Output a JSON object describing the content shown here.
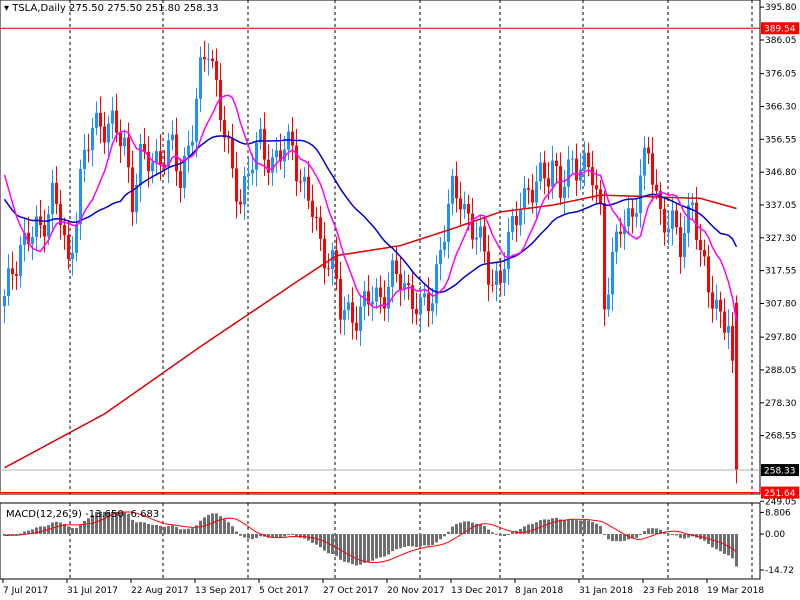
{
  "header": {
    "symbol": "TSLA,Daily",
    "open": "275.50",
    "high": "275.50",
    "low": "251.80",
    "close": "258.33"
  },
  "macd_header": {
    "label": "MACD(12,26,9)",
    "main": "-13.650",
    "signal": "-6.683"
  },
  "colors": {
    "bull": "#1e90ff",
    "bear": "#ff0000",
    "ma_fast": "#ff00ff",
    "ma_mid": "#0000cd",
    "ma_slow": "#e00000",
    "hist": "#6e6e6e",
    "signal": "#ff0000"
  },
  "chart_data": {
    "type": "candlestick",
    "title": "TSLA,Daily",
    "price_ticks": [
      "395.80",
      "386.05",
      "376.05",
      "366.30",
      "356.55",
      "346.80",
      "337.05",
      "327.30",
      "317.55",
      "307.80",
      "297.80",
      "288.05",
      "278.30",
      "268.55",
      "249.05"
    ],
    "price_range": [
      249.05,
      395.8
    ],
    "price_tags": [
      {
        "value": "389.54",
        "kind": "red-line"
      },
      {
        "value": "258.33",
        "kind": "last-price"
      },
      {
        "value": "251.64",
        "kind": "red-line"
      }
    ],
    "date_labels": [
      "7 Jul 2017",
      "31 Jul 2017",
      "22 Aug 2017",
      "13 Sep 2017",
      "5 Oct 2017",
      "27 Oct 2017",
      "20 Nov 2017",
      "13 Dec 2017",
      "8 Jan 2018",
      "31 Jan 2018",
      "23 Feb 2018",
      "19 Mar 2018"
    ],
    "bars_total": 184,
    "close_keypoints": [
      [
        0,
        308
      ],
      [
        2,
        318
      ],
      [
        4,
        325
      ],
      [
        9,
        330
      ],
      [
        12,
        340
      ],
      [
        14,
        333
      ],
      [
        16,
        318
      ],
      [
        19,
        345
      ],
      [
        22,
        360
      ],
      [
        24,
        362
      ],
      [
        27,
        360
      ],
      [
        30,
        355
      ],
      [
        32,
        340
      ],
      [
        34,
        350
      ],
      [
        37,
        350
      ],
      [
        39,
        352
      ],
      [
        42,
        353
      ],
      [
        44,
        345
      ],
      [
        47,
        360
      ],
      [
        49,
        375
      ],
      [
        51,
        385
      ],
      [
        52,
        380
      ],
      [
        54,
        365
      ],
      [
        57,
        345
      ],
      [
        59,
        340
      ],
      [
        62,
        350
      ],
      [
        64,
        355
      ],
      [
        67,
        350
      ],
      [
        69,
        352
      ],
      [
        72,
        355
      ],
      [
        74,
        345
      ],
      [
        77,
        335
      ],
      [
        79,
        325
      ],
      [
        82,
        320
      ],
      [
        84,
        305
      ],
      [
        87,
        305
      ],
      [
        89,
        305
      ],
      [
        92,
        310
      ],
      [
        94,
        310
      ],
      [
        97,
        315
      ],
      [
        99,
        315
      ],
      [
        102,
        310
      ],
      [
        104,
        305
      ],
      [
        107,
        310
      ],
      [
        109,
        325
      ],
      [
        112,
        340
      ],
      [
        114,
        340
      ],
      [
        117,
        330
      ],
      [
        119,
        325
      ],
      [
        122,
        315
      ],
      [
        124,
        315
      ],
      [
        127,
        330
      ],
      [
        129,
        340
      ],
      [
        132,
        340
      ],
      [
        134,
        345
      ],
      [
        137,
        350
      ],
      [
        139,
        340
      ],
      [
        142,
        350
      ],
      [
        144,
        350
      ],
      [
        147,
        345
      ],
      [
        149,
        335
      ],
      [
        150,
        310
      ],
      [
        152,
        320
      ],
      [
        154,
        330
      ],
      [
        157,
        335
      ],
      [
        159,
        345
      ],
      [
        161,
        352
      ],
      [
        163,
        340
      ],
      [
        164,
        335
      ],
      [
        167,
        330
      ],
      [
        169,
        325
      ],
      [
        172,
        340
      ],
      [
        173,
        330
      ],
      [
        174,
        320
      ],
      [
        177,
        310
      ],
      [
        179,
        305
      ],
      [
        181,
        300
      ],
      [
        182,
        285
      ],
      [
        183,
        258.33
      ]
    ],
    "ma_slow_keypoints": [
      [
        0,
        259
      ],
      [
        25,
        275
      ],
      [
        49,
        295
      ],
      [
        74,
        315
      ],
      [
        83,
        322
      ],
      [
        99,
        325
      ],
      [
        112,
        330
      ],
      [
        124,
        335
      ],
      [
        137,
        337
      ],
      [
        149,
        340
      ],
      [
        174,
        339
      ],
      [
        183,
        336
      ]
    ],
    "macd": {
      "fast": 12,
      "slow": 26,
      "signal": 9,
      "ticks": [
        "8.806",
        "0.00",
        "-14.72"
      ],
      "range": [
        -14.72,
        8.806
      ],
      "current_main": -13.65,
      "current_signal": -6.683
    }
  }
}
